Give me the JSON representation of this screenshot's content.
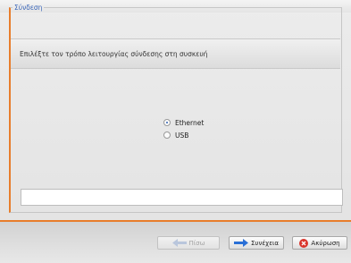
{
  "group": {
    "title": "Σύνδεση"
  },
  "instruction": {
    "text": "Επιλέξτε τον τρόπο λειτουργίας σύνδεσης στη συσκευή"
  },
  "connection_options": [
    {
      "label": "Ethernet",
      "selected": true
    },
    {
      "label": "USB",
      "selected": false
    }
  ],
  "status": {
    "text": ""
  },
  "footer": {
    "back_label": "Πίσω",
    "next_label": "Συνέχεια",
    "cancel_label": "Ακύρωση"
  },
  "colors": {
    "accent": "#e87d2b",
    "legend": "#3b66b8",
    "next_arrow": "#2a6fd6",
    "cancel_icon": "#d9342b"
  },
  "icons": {
    "back": "arrow-left-icon",
    "next": "arrow-right-icon",
    "cancel": "cancel-icon"
  }
}
